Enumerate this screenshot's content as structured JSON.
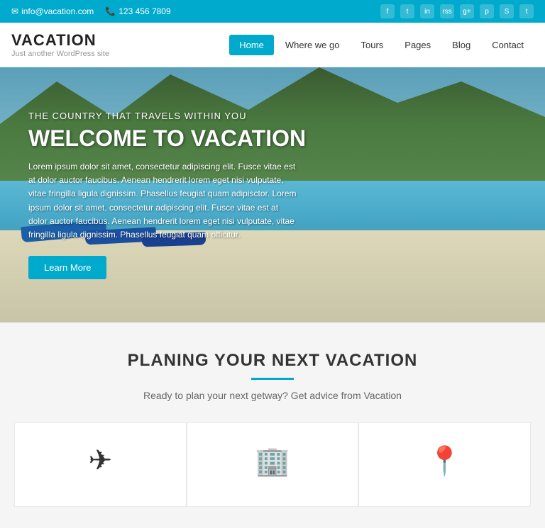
{
  "topbar": {
    "email": "info@vacation.com",
    "phone": "123 456 7809",
    "email_icon": "✉",
    "phone_icon": "📞",
    "socials": [
      "f",
      "t",
      "in",
      "rss",
      "g+",
      "p",
      "sk",
      "t2"
    ]
  },
  "header": {
    "logo_title": "VACATION",
    "logo_sub": "Just another WordPress site"
  },
  "nav": {
    "items": [
      {
        "label": "Home",
        "active": true
      },
      {
        "label": "Where we go",
        "active": false
      },
      {
        "label": "Tours",
        "active": false
      },
      {
        "label": "Pages",
        "active": false
      },
      {
        "label": "Blog",
        "active": false
      },
      {
        "label": "Contact",
        "active": false
      }
    ]
  },
  "hero": {
    "subtitle": "THE COUNTRY THAT TRAVELS WITHIN YOU",
    "title": "WELCOME TO VACATION",
    "body": "Lorem ipsum dolor sit amet, consectetur adipiscing elit. Fusce vitae est at dolor auctor faucibus. Aenean hendrerit lorem eget nisi vulputate, vitae fringilla ligula dignissim. Phasellus feugiat quam adipisctor. Lorem ipsum dolor sit amet, consectetur adipiscing elit. Fusce vitae est at dolor auctor faucibus. Aenean hendrerit lorem eget nisi vulputate, vitae fringilla ligula dignissim. Phasellus feugiat quam officitur.",
    "button_label": "Learn More"
  },
  "planning": {
    "title": "PLANING YOUR NEXT VACATION",
    "subtitle": "Ready to plan your next getway? Get advice from Vacation"
  },
  "cards": [
    {
      "icon": "✈",
      "name": "flights"
    },
    {
      "icon": "🏢",
      "name": "hotels"
    },
    {
      "icon": "📍",
      "name": "destinations"
    }
  ]
}
